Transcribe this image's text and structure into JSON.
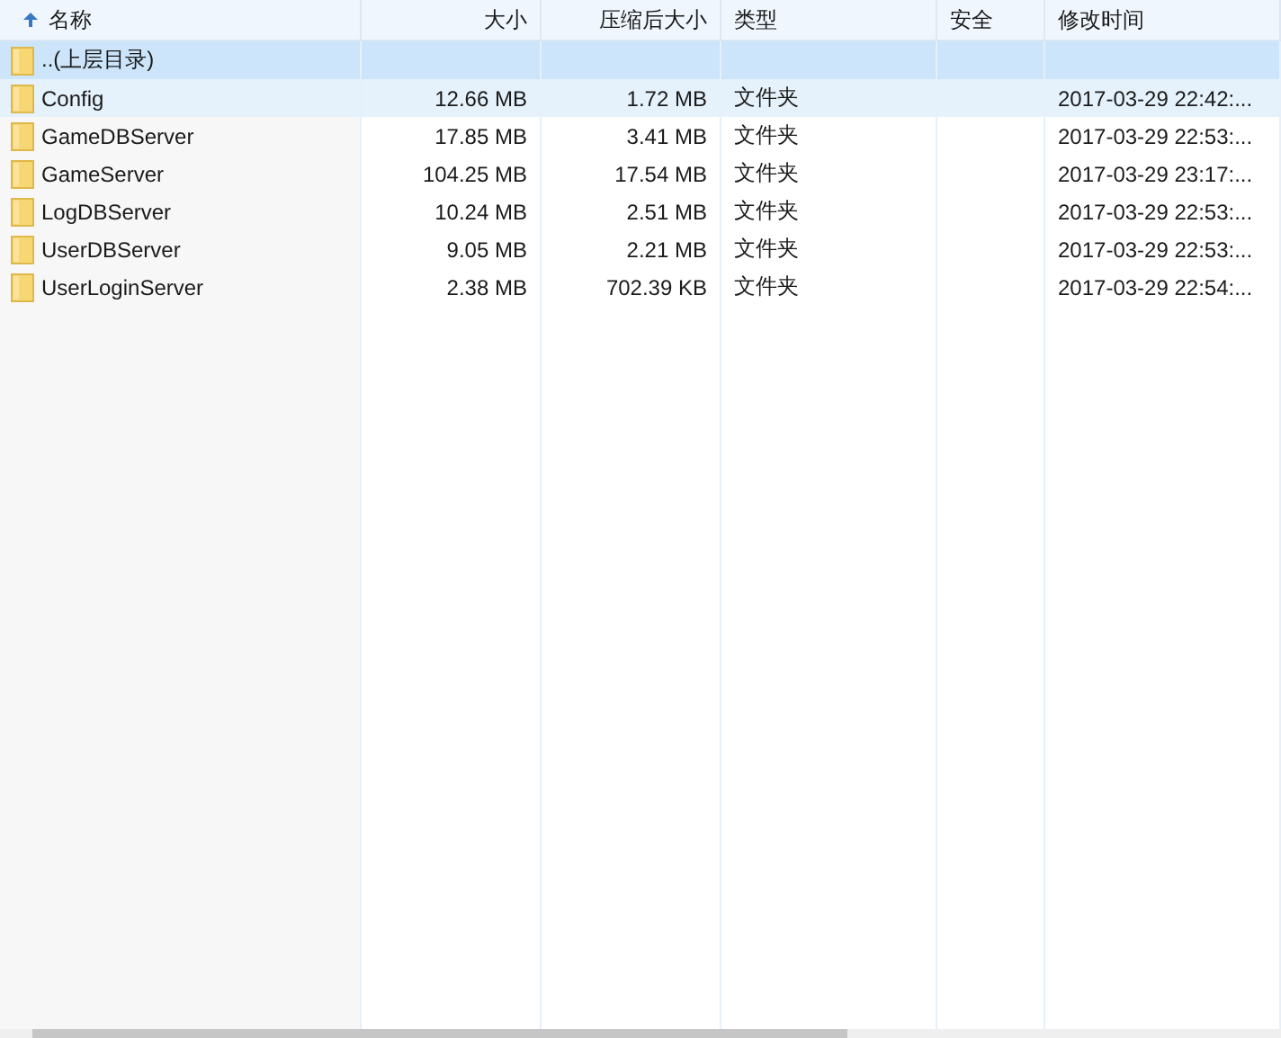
{
  "columns": [
    {
      "label": "名称",
      "sorted": true
    },
    {
      "label": "大小",
      "sorted": false
    },
    {
      "label": "压缩后大小",
      "sorted": false
    },
    {
      "label": "类型",
      "sorted": false
    },
    {
      "label": "安全",
      "sorted": false
    },
    {
      "label": "修改时间",
      "sorted": false
    }
  ],
  "rows": [
    {
      "name": "..(上层目录)",
      "size": "",
      "packed": "",
      "type": "",
      "security": "",
      "modified": "",
      "selected": true,
      "highlighted": false
    },
    {
      "name": "Config",
      "size": "12.66 MB",
      "packed": "1.72 MB",
      "type": "文件夹",
      "security": "",
      "modified": "2017-03-29 22:42:...",
      "selected": false,
      "highlighted": true
    },
    {
      "name": "GameDBServer",
      "size": "17.85 MB",
      "packed": "3.41 MB",
      "type": "文件夹",
      "security": "",
      "modified": "2017-03-29 22:53:...",
      "selected": false,
      "highlighted": false
    },
    {
      "name": "GameServer",
      "size": "104.25 MB",
      "packed": "17.54 MB",
      "type": "文件夹",
      "security": "",
      "modified": "2017-03-29 23:17:...",
      "selected": false,
      "highlighted": false
    },
    {
      "name": "LogDBServer",
      "size": "10.24 MB",
      "packed": "2.51 MB",
      "type": "文件夹",
      "security": "",
      "modified": "2017-03-29 22:53:...",
      "selected": false,
      "highlighted": false
    },
    {
      "name": "UserDBServer",
      "size": "9.05 MB",
      "packed": "2.21 MB",
      "type": "文件夹",
      "security": "",
      "modified": "2017-03-29 22:53:...",
      "selected": false,
      "highlighted": false
    },
    {
      "name": "UserLoginServer",
      "size": "2.38 MB",
      "packed": "702.39 KB",
      "type": "文件夹",
      "security": "",
      "modified": "2017-03-29 22:54:...",
      "selected": false,
      "highlighted": false
    }
  ]
}
